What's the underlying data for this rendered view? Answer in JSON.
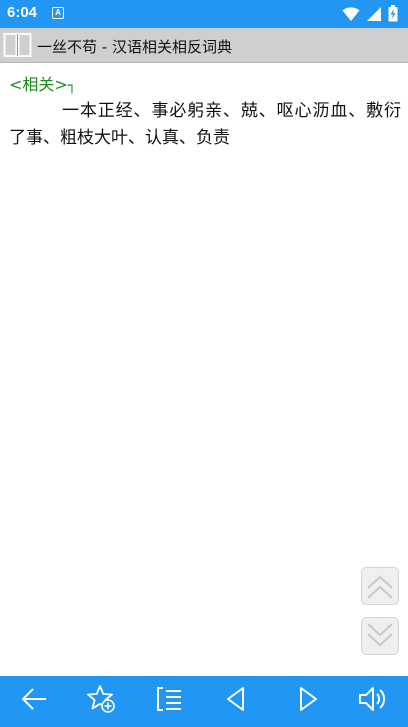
{
  "status_bar": {
    "time": "6:04",
    "notification_icon_letter": "A",
    "icons": [
      "wifi-icon",
      "signal-icon",
      "battery-icon"
    ]
  },
  "title_bar": {
    "icon": "book-icon",
    "title": "一丝不苟 - 汉语相关相反词典"
  },
  "content": {
    "section_label": "<相关>",
    "section_mark": "┐",
    "text": "一本正经、事必躬亲、兢、呕心沥血、敷衍了事、粗枝大叶、认真、负责"
  },
  "scroll_buttons": [
    "scroll-up-icon",
    "scroll-down-icon"
  ],
  "bottom_bar": {
    "icons": [
      "back-arrow-icon",
      "favorite-add-icon",
      "list-icon",
      "previous-icon",
      "next-icon",
      "speaker-icon"
    ]
  },
  "colors": {
    "accent": "#2196f3",
    "title_bar": "#cfcfcf",
    "label_green": "#1e8b1e"
  }
}
